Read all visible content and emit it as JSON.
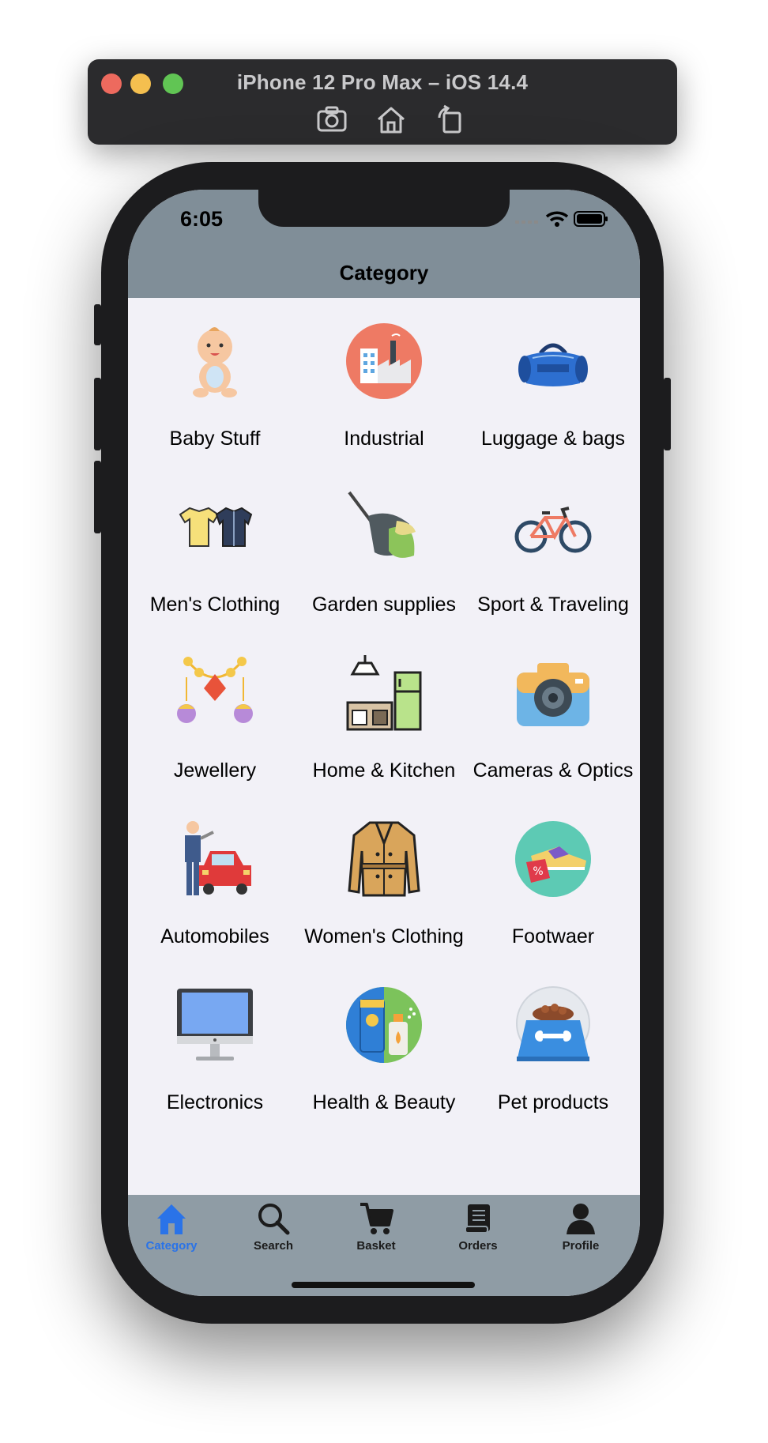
{
  "simulator": {
    "title": "iPhone 12 Pro Max – iOS 14.4",
    "tools": [
      "screenshot-icon",
      "home-icon",
      "rotate-icon"
    ]
  },
  "status_bar": {
    "time": "6:05"
  },
  "nav": {
    "title": "Category"
  },
  "categories": [
    {
      "label": "Baby Stuff",
      "icon": "baby-icon"
    },
    {
      "label": "Industrial",
      "icon": "factory-icon"
    },
    {
      "label": "Luggage & bags",
      "icon": "duffel-bag-icon"
    },
    {
      "label": "Men's Clothing",
      "icon": "shirts-icon"
    },
    {
      "label": "Garden supplies",
      "icon": "watering-can-icon"
    },
    {
      "label": "Sport & Traveling",
      "icon": "bicycle-icon"
    },
    {
      "label": "Jewellery",
      "icon": "necklace-icon"
    },
    {
      "label": "Home & Kitchen",
      "icon": "kitchen-icon"
    },
    {
      "label": "Cameras & Optics",
      "icon": "camera-icon"
    },
    {
      "label": "Automobiles",
      "icon": "mechanic-car-icon"
    },
    {
      "label": "Women's Clothing",
      "icon": "trench-coat-icon"
    },
    {
      "label": "Footwaer",
      "icon": "sneaker-icon"
    },
    {
      "label": "Electronics",
      "icon": "monitor-icon"
    },
    {
      "label": "Health & Beauty",
      "icon": "cosmetics-icon"
    },
    {
      "label": "Pet products",
      "icon": "pet-bowl-icon"
    }
  ],
  "tabs": [
    {
      "label": "Category",
      "icon": "home-icon",
      "active": true
    },
    {
      "label": "Search",
      "icon": "search-icon",
      "active": false
    },
    {
      "label": "Basket",
      "icon": "cart-icon",
      "active": false
    },
    {
      "label": "Orders",
      "icon": "orders-icon",
      "active": false
    },
    {
      "label": "Profile",
      "icon": "profile-icon",
      "active": false
    }
  ],
  "colors": {
    "nav_bar": "#808e98",
    "tab_bar": "#8f9ca5",
    "active_tab": "#2a73e8",
    "content_bg": "#f2f1f7"
  }
}
